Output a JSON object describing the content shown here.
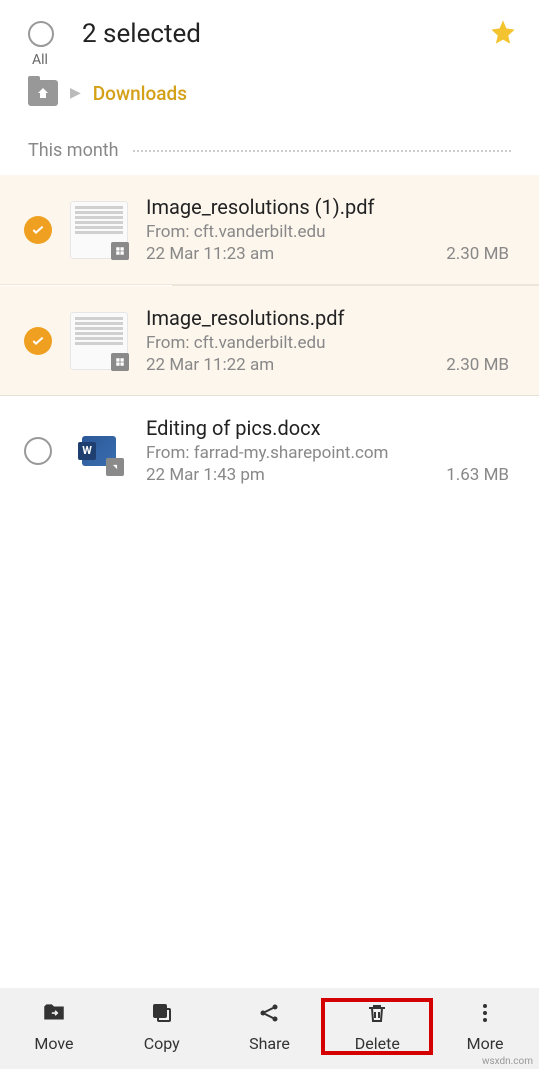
{
  "header": {
    "title": "2 selected",
    "all_label": "All"
  },
  "breadcrumb": {
    "current": "Downloads"
  },
  "section": {
    "label": "This month"
  },
  "files": [
    {
      "name": "Image_resolutions (1).pdf",
      "from": "From: cft.vanderbilt.edu",
      "date": "22 Mar 11:23 am",
      "size": "2.30 MB",
      "selected": true,
      "type": "pdf"
    },
    {
      "name": "Image_resolutions.pdf",
      "from": "From: cft.vanderbilt.edu",
      "date": "22 Mar 11:22 am",
      "size": "2.30 MB",
      "selected": true,
      "type": "pdf"
    },
    {
      "name": "Editing of pics.docx",
      "from": "From: farrad-my.sharepoint.com",
      "date": "22 Mar 1:43 pm",
      "size": "1.63 MB",
      "selected": false,
      "type": "docx"
    }
  ],
  "bottom_bar": {
    "move": "Move",
    "copy": "Copy",
    "share": "Share",
    "delete": "Delete",
    "more": "More"
  },
  "watermark": "wsxdn.com"
}
